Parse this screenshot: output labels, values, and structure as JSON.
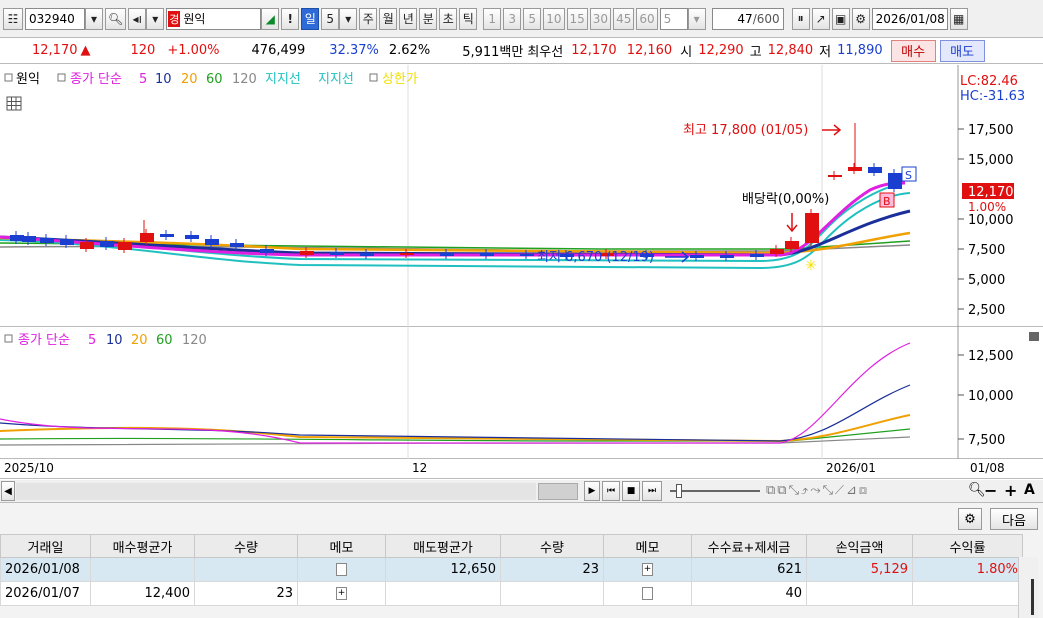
{
  "toolbar": {
    "code": "032940",
    "badge": "경",
    "name": "원익",
    "excl": "!",
    "period_day": "일",
    "period_n": "5",
    "periods": [
      "주",
      "월",
      "년",
      "분",
      "초",
      "틱"
    ],
    "intervals": [
      "1",
      "3",
      "5",
      "10",
      "15",
      "30",
      "45",
      "60"
    ],
    "interval_sel": "5",
    "count_value": "47",
    "count_total": "/600",
    "date": "2026/01/08"
  },
  "quote": {
    "price": "12,170",
    "arrow": "▲",
    "change": "120",
    "change_pct": "+1.00%",
    "volume": "476,499",
    "vol_ratio": "32.37%",
    "turnover": "2.62%",
    "amount": "5,911백만",
    "best_label": "최우선",
    "ask": "12,170",
    "bid": "12,160",
    "open_label": "시",
    "open": "12,290",
    "high_label": "고",
    "high": "12,840",
    "low_label": "저",
    "low": "11,890",
    "buy_button": "매수",
    "sell_button": "매도"
  },
  "price_chart": {
    "legend": [
      "원익",
      "종가 단순",
      "5",
      "10",
      "20",
      "60",
      "120",
      "지지선",
      "지지선",
      "상한가"
    ],
    "lc": "LC:82.46",
    "hc": "HC:-31.63",
    "y_ticks": [
      "17,500",
      "15,000",
      "12,170",
      "10,000",
      "7,500",
      "5,000",
      "2,500"
    ],
    "current_label": "12,170",
    "current_pct": "1.00%",
    "high_note": "최고 17,800 (01/05)",
    "low_note": "최저 6,670 (12/19)",
    "dividend_note": "배당락(0,00%)",
    "buy_marker": "B",
    "sell_marker": "S"
  },
  "ma_chart": {
    "legend": [
      "종가 단순",
      "5",
      "10",
      "20",
      "60",
      "120"
    ],
    "y_ticks": [
      "12,500",
      "10,000",
      "7,500"
    ]
  },
  "xaxis": {
    "labels": [
      "2025/10",
      "12",
      "2026/01"
    ],
    "right": "01/08"
  },
  "lower": {
    "next_button": "다음",
    "headers": [
      "거래일",
      "매수평균가",
      "수량",
      "메모",
      "매도평균가",
      "수량",
      "메모",
      "수수료+제세금",
      "손익금액",
      "수익률"
    ],
    "rows": [
      {
        "date": "2026/01/08",
        "buy_avg": "",
        "buy_qty": "",
        "sell_avg": "12,650",
        "sell_qty": "23",
        "fee": "621",
        "pnl": "5,129",
        "ret": "1.80%"
      },
      {
        "date": "2026/01/07",
        "buy_avg": "12,400",
        "buy_qty": "23",
        "sell_avg": "",
        "sell_qty": "",
        "fee": "40",
        "pnl": "",
        "ret": ""
      }
    ]
  },
  "colors": {
    "up": "#e01010",
    "down": "#1a3fd0",
    "ma5": "#e020e0",
    "ma10": "#1a2f9a",
    "ma20": "#f0a000",
    "ma60": "#20a020",
    "ma120": "#888888",
    "support": "#20c0c0"
  }
}
